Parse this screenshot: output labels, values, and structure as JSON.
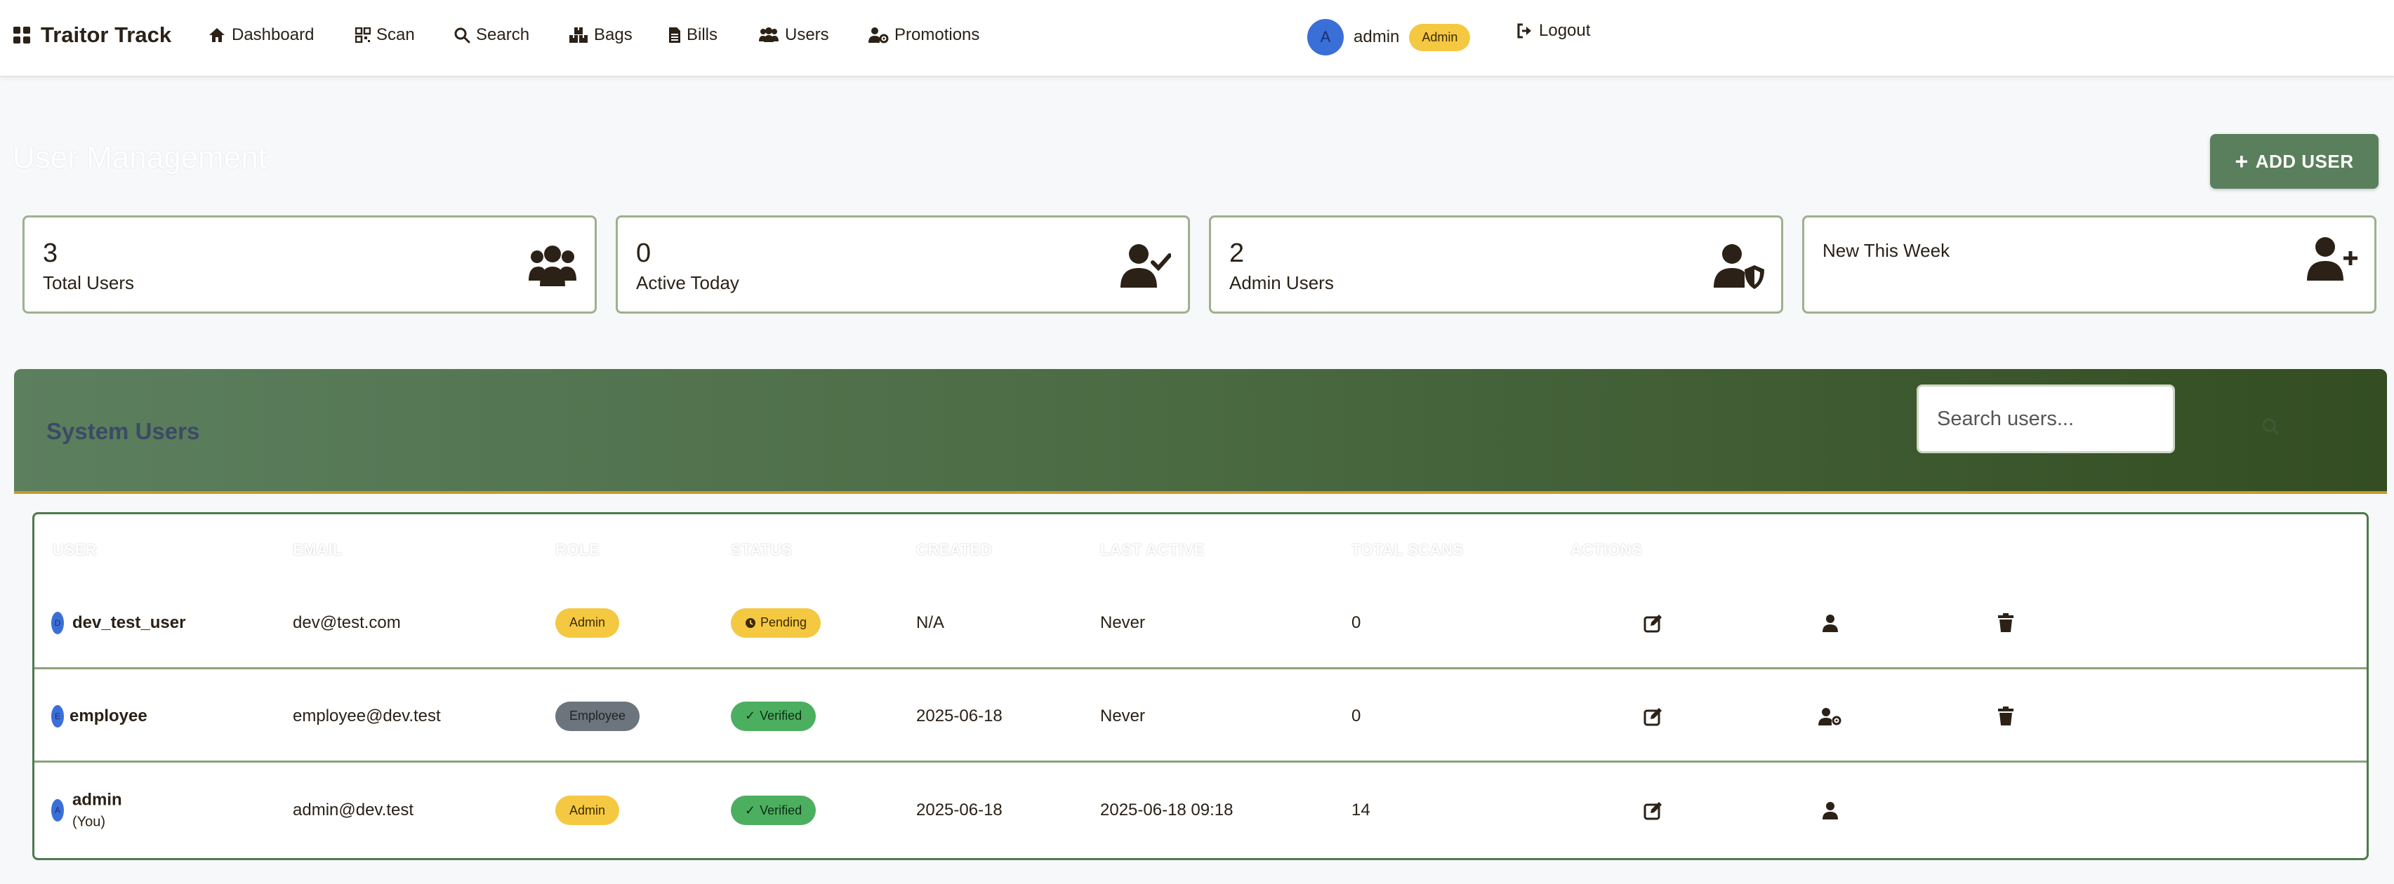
{
  "navbar": {
    "brand": "Traitor Track",
    "items": [
      {
        "label": "Dashboard",
        "icon": "home-icon"
      },
      {
        "label": "Scan",
        "icon": "qr-icon"
      },
      {
        "label": "Search",
        "icon": "search-icon"
      },
      {
        "label": "Bags",
        "icon": "boxes-icon"
      },
      {
        "label": "Bills",
        "icon": "file-icon"
      },
      {
        "label": "Users",
        "icon": "users-icon"
      },
      {
        "label": "Promotions",
        "icon": "user-cog-icon"
      }
    ],
    "user": {
      "avatar_letter": "A",
      "name": "admin",
      "badge": "Admin"
    },
    "logout": "Logout"
  },
  "page": {
    "title": "User Management",
    "add_button": "ADD USER"
  },
  "stats": [
    {
      "value": "3",
      "label": "Total Users",
      "icon": "users-icon"
    },
    {
      "value": "0",
      "label": "Active Today",
      "icon": "user-check-icon"
    },
    {
      "value": "2",
      "label": "Admin Users",
      "icon": "user-shield-icon"
    },
    {
      "value": "",
      "label": "New This Week",
      "icon": "user-plus-icon"
    }
  ],
  "panel": {
    "title": "System Users",
    "search_placeholder": "Search users..."
  },
  "table": {
    "headers": [
      "USER",
      "EMAIL",
      "ROLE",
      "STATUS",
      "CREATED",
      "LAST ACTIVE",
      "TOTAL SCANS",
      "ACTIONS"
    ],
    "rows": [
      {
        "avatar": "D",
        "username": "dev_test_user",
        "sub": "",
        "email": "dev@test.com",
        "role": "Admin",
        "status": "Pending",
        "created": "N/A",
        "last_active": "Never",
        "total_scans": "0",
        "actions": [
          "edit-icon",
          "user-icon",
          "trash-icon"
        ]
      },
      {
        "avatar": "E",
        "username": "employee",
        "sub": "",
        "email": "employee@dev.test",
        "role": "Employee",
        "status": "Verified",
        "created": "2025-06-18",
        "last_active": "Never",
        "total_scans": "0",
        "actions": [
          "edit-icon",
          "user-cog-icon",
          "trash-icon"
        ]
      },
      {
        "avatar": "A",
        "username": "admin",
        "sub": "(You)",
        "email": "admin@dev.test",
        "role": "Admin",
        "status": "Verified",
        "created": "2025-06-18",
        "last_active": "2025-06-18 09:18",
        "total_scans": "14",
        "actions": [
          "edit-icon",
          "user-icon"
        ]
      }
    ]
  },
  "colors": {
    "accent_green": "#5a7f5c",
    "admin_yellow": "#f5c842",
    "verified_green": "#4caf60",
    "employee_gray": "#6c757d",
    "avatar_blue": "#3b6fd8"
  }
}
